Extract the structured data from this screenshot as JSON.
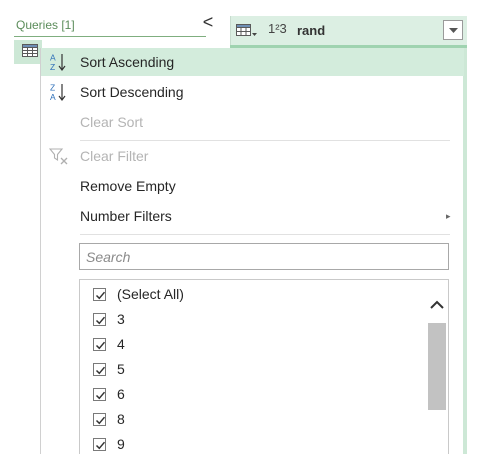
{
  "queries_pane": {
    "title": "Queries [1]",
    "collapse_glyph": "<"
  },
  "column_header": {
    "type_icon": "table-type-icon",
    "number_type_label": "1²3",
    "column_name": "rand",
    "dropdown_icon": "chevron-down-icon"
  },
  "menu": {
    "sort_ascending": "Sort Ascending",
    "sort_descending": "Sort Descending",
    "clear_sort": "Clear Sort",
    "clear_filter": "Clear Filter",
    "remove_empty": "Remove Empty",
    "number_filters": "Number Filters",
    "submenu_arrow": "▸"
  },
  "search": {
    "placeholder": "Search",
    "value": ""
  },
  "checklist": {
    "items": [
      {
        "label": "(Select All)",
        "checked": true
      },
      {
        "label": "3",
        "checked": true
      },
      {
        "label": "4",
        "checked": true
      },
      {
        "label": "5",
        "checked": true
      },
      {
        "label": "6",
        "checked": true
      },
      {
        "label": "8",
        "checked": true
      },
      {
        "label": "9",
        "checked": true
      }
    ]
  },
  "colors": {
    "accent_green": "#d3ecdc",
    "header_green": "#dcefe3",
    "sort_icon_blue": "#2d6fb8",
    "disabled_text": "#b4b4b4"
  }
}
